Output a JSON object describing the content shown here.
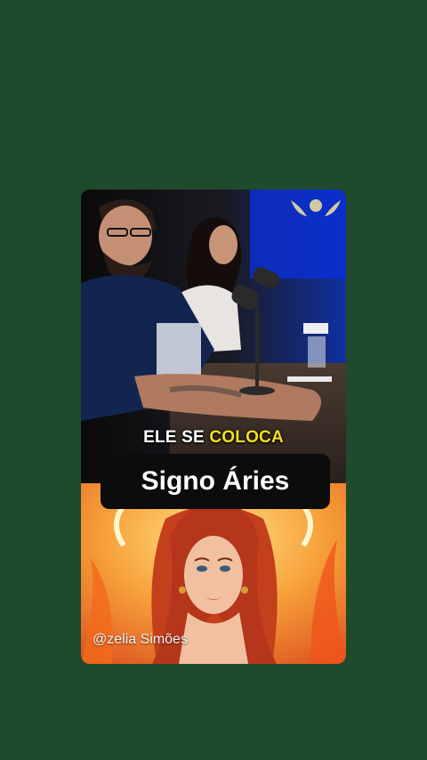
{
  "video": {
    "caption_prefix": "ELE SE",
    "caption_highlight": "COLOCA",
    "title": "Signo Áries",
    "watermark": "@zelia Simões"
  },
  "colors": {
    "background": "#1f4a2c",
    "highlight": "#f4e11a",
    "pill": "#0c0c0c"
  }
}
